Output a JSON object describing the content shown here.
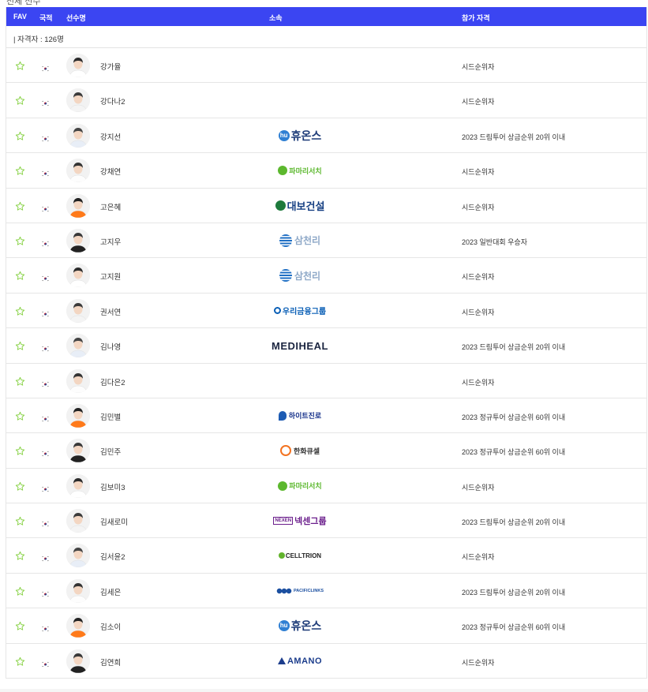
{
  "page": {
    "top_cut_text": "전체 선수"
  },
  "table": {
    "headers": {
      "fav": "FAV",
      "nation": "국적",
      "player": "선수명",
      "team": "소속",
      "qualification": "참가 자격"
    },
    "qualified_label": "| 자격자 : 126명",
    "rows": [
      {
        "name": "강가율",
        "sponsor": "",
        "sponsor_style": "none",
        "qualification": "시드순위자"
      },
      {
        "name": "강다나2",
        "sponsor": "",
        "sponsor_style": "none",
        "qualification": "시드순위자"
      },
      {
        "name": "강지선",
        "sponsor": "휴온스",
        "sponsor_style": "huons",
        "qualification": "2023 드림투어 상금순위 20위 이내"
      },
      {
        "name": "강채연",
        "sponsor": "파마리서치",
        "sponsor_style": "pharma",
        "qualification": "시드순위자"
      },
      {
        "name": "고은혜",
        "sponsor": "대보건설",
        "sponsor_style": "daebo",
        "qualification": "시드순위자"
      },
      {
        "name": "고지우",
        "sponsor": "삼천리",
        "sponsor_style": "samchully",
        "qualification": "2023 일반대회 우승자"
      },
      {
        "name": "고지원",
        "sponsor": "삼천리",
        "sponsor_style": "samchully",
        "qualification": "시드순위자"
      },
      {
        "name": "권서연",
        "sponsor": "우리금융그룹",
        "sponsor_style": "woori",
        "qualification": "시드순위자"
      },
      {
        "name": "김나영",
        "sponsor": "MEDIHEAL",
        "sponsor_style": "mediheal",
        "qualification": "2023 드림투어 상금순위 20위 이내"
      },
      {
        "name": "김다은2",
        "sponsor": "",
        "sponsor_style": "none",
        "qualification": "시드순위자"
      },
      {
        "name": "김민별",
        "sponsor": "하이트진로",
        "sponsor_style": "hite",
        "qualification": "2023 정규투어 상금순위 60위 이내"
      },
      {
        "name": "김민주",
        "sponsor": "한화큐셀",
        "sponsor_style": "hanwha",
        "qualification": "2023 정규투어 상금순위 60위 이내"
      },
      {
        "name": "김보미3",
        "sponsor": "파마리서치",
        "sponsor_style": "pharma",
        "qualification": "시드순위자"
      },
      {
        "name": "김새로미",
        "sponsor": "넥센그룹",
        "sponsor_style": "nexen",
        "qualification": "2023 드림투어 상금순위 20위 이내"
      },
      {
        "name": "김서윤2",
        "sponsor": "CELLTRION",
        "sponsor_style": "celltrion",
        "qualification": "시드순위자"
      },
      {
        "name": "김세은",
        "sponsor": "PACIFICLINKS",
        "sponsor_style": "pacific",
        "qualification": "2023 드림투어 상금순위 20위 이내"
      },
      {
        "name": "김소이",
        "sponsor": "휴온스",
        "sponsor_style": "huons",
        "qualification": "2023 정규투어 상금순위 60위 이내"
      },
      {
        "name": "김연희",
        "sponsor": "AMANO",
        "sponsor_style": "amano",
        "qualification": "시드순위자"
      }
    ]
  },
  "colors": {
    "header_bg": "#3b45f2",
    "star": "#8bd34b",
    "flag_red": "#cd2e3a",
    "flag_blue": "#0047a0"
  },
  "icons": {
    "fav": "star-outline-icon",
    "nation": "korea-flag-icon"
  }
}
